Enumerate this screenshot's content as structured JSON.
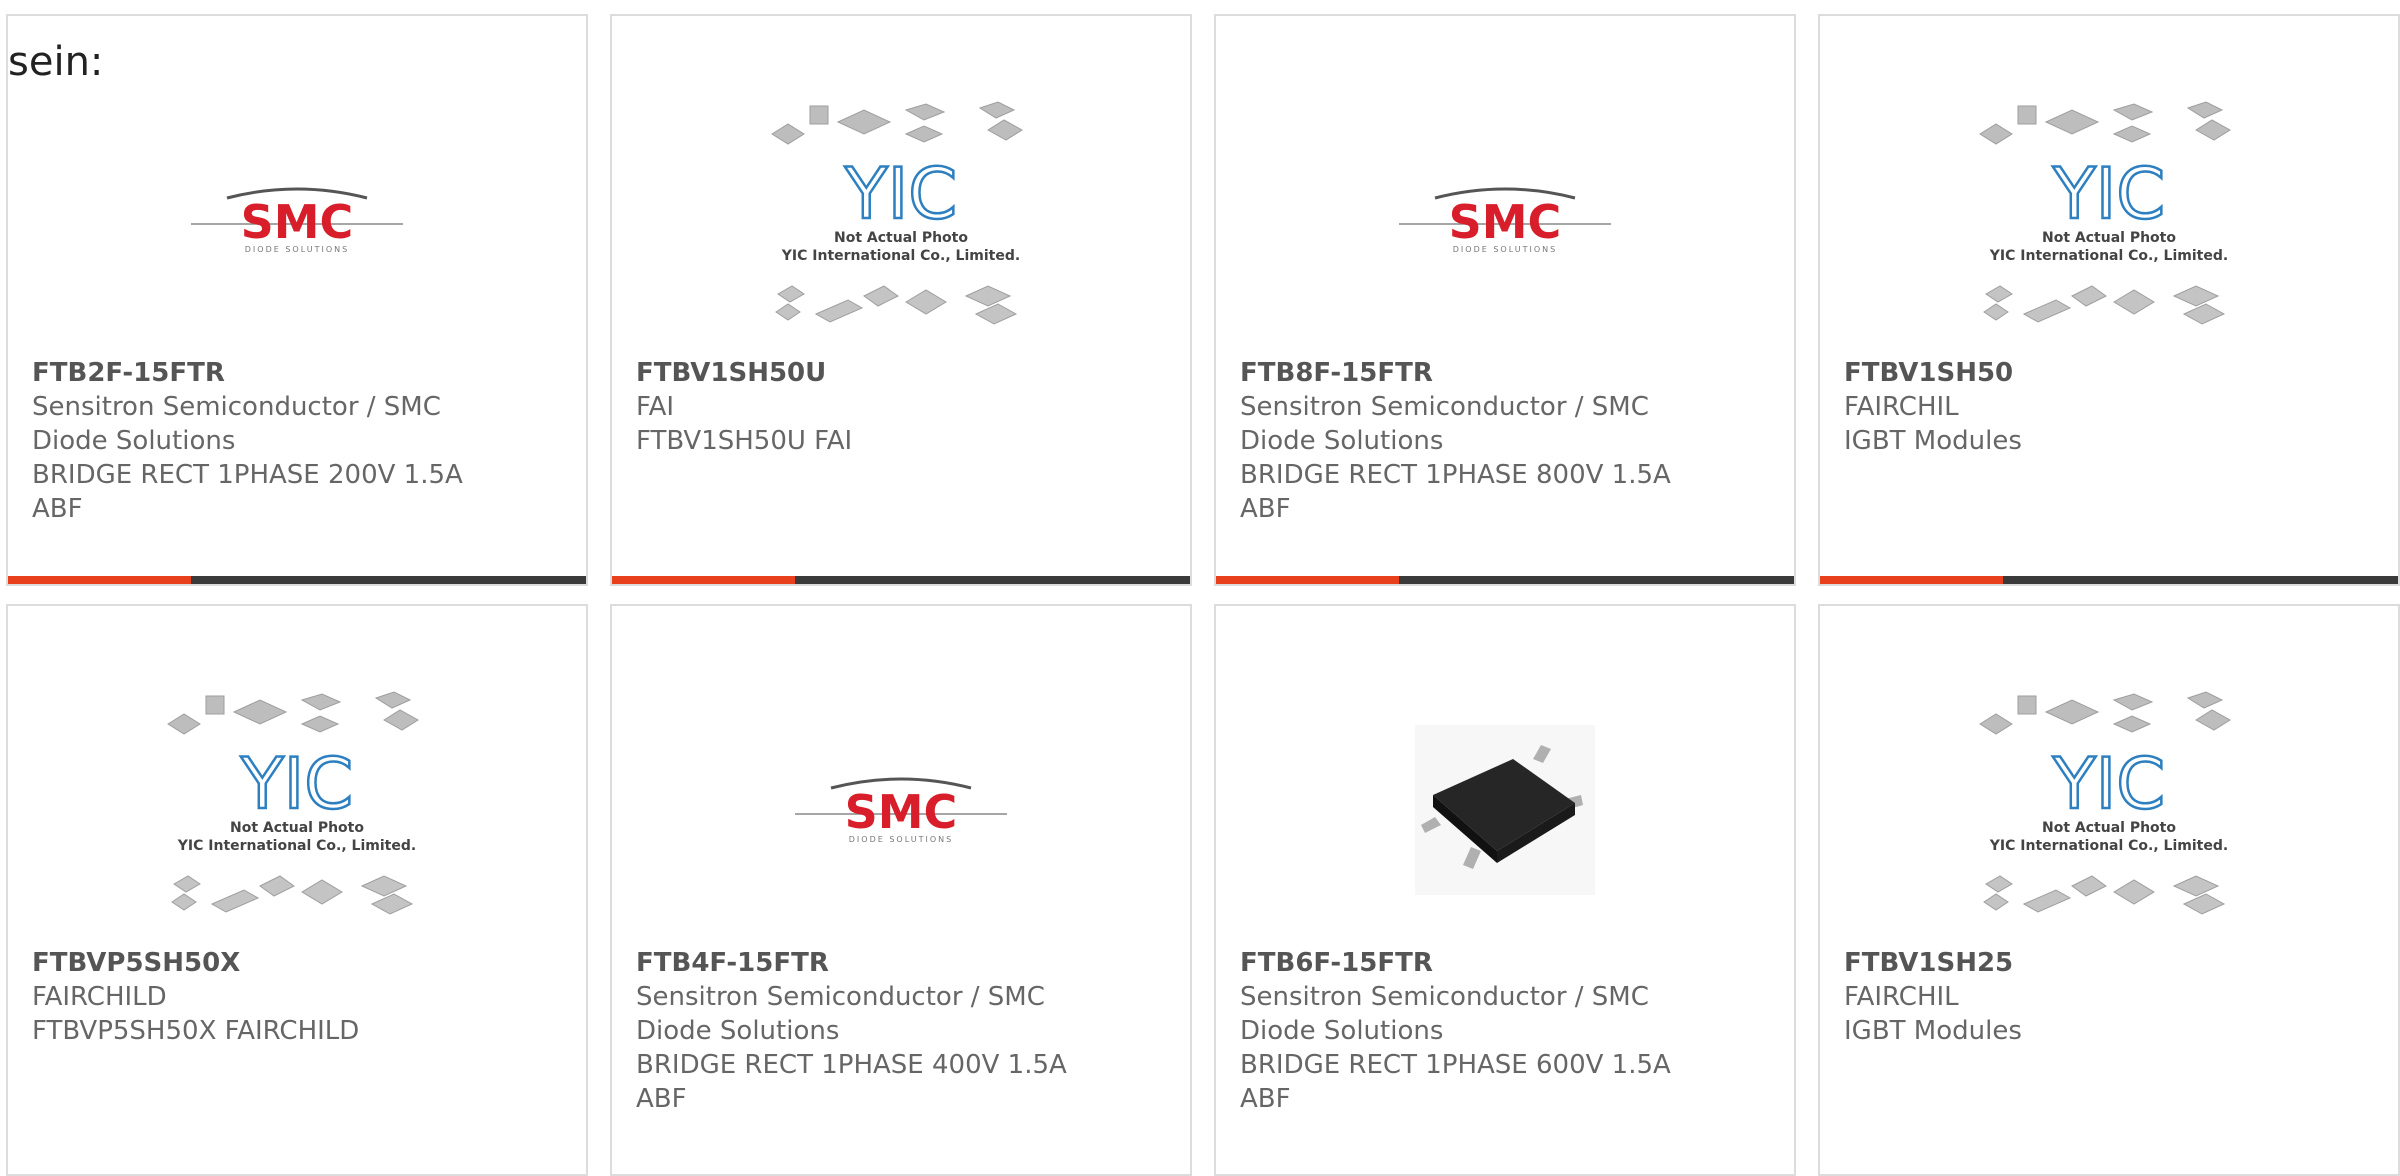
{
  "intro_text": "sein:",
  "accent_color": "#e8401c",
  "products": [
    {
      "part": "FTB2F-15FTR",
      "lines": [
        "Sensitron Semiconductor / SMC",
        "Diode Solutions",
        "BRIDGE RECT 1PHASE 200V 1.5A",
        "ABF"
      ],
      "image": "smc-logo",
      "logo_text": "SMC",
      "logo_sub": "DIODE SOLUTIONS"
    },
    {
      "part": "FTBV1SH50U",
      "lines": [
        "FAI",
        "FTBV1SH50U FAI"
      ],
      "image": "yic-placeholder",
      "logo_text": "YIC",
      "caption1": "Not Actual Photo",
      "caption2": "YIC International Co., Limited."
    },
    {
      "part": "FTB8F-15FTR",
      "lines": [
        "Sensitron Semiconductor / SMC",
        "Diode Solutions",
        "BRIDGE RECT 1PHASE 800V 1.5A",
        "ABF"
      ],
      "image": "smc-logo",
      "logo_text": "SMC",
      "logo_sub": "DIODE SOLUTIONS"
    },
    {
      "part": "FTBV1SH50",
      "lines": [
        "FAIRCHIL",
        "IGBT Modules"
      ],
      "image": "yic-placeholder",
      "logo_text": "YIC",
      "caption1": "Not Actual Photo",
      "caption2": "YIC International Co., Limited."
    },
    {
      "part": "FTBVP5SH50X",
      "lines": [
        "FAIRCHILD",
        "FTBVP5SH50X FAIRCHILD"
      ],
      "image": "yic-placeholder",
      "logo_text": "YIC",
      "caption1": "Not Actual Photo",
      "caption2": "YIC International Co., Limited."
    },
    {
      "part": "FTB4F-15FTR",
      "lines": [
        "Sensitron Semiconductor / SMC",
        "Diode Solutions",
        "BRIDGE RECT 1PHASE 400V 1.5A",
        "ABF"
      ],
      "image": "smc-logo",
      "logo_text": "SMC",
      "logo_sub": "DIODE SOLUTIONS"
    },
    {
      "part": "FTB6F-15FTR",
      "lines": [
        "Sensitron Semiconductor / SMC",
        "Diode Solutions",
        "BRIDGE RECT 1PHASE 600V 1.5A",
        "ABF"
      ],
      "image": "chip-photo"
    },
    {
      "part": "FTBV1SH25",
      "lines": [
        "FAIRCHIL",
        "IGBT Modules"
      ],
      "image": "yic-placeholder",
      "logo_text": "YIC",
      "caption1": "Not Actual Photo",
      "caption2": "YIC International Co., Limited."
    }
  ]
}
